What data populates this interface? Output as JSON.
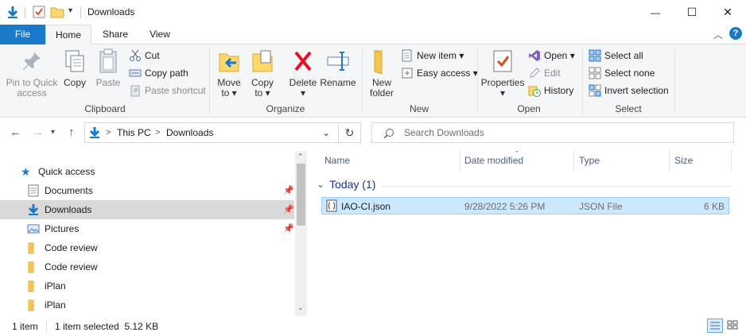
{
  "window": {
    "title": "Downloads",
    "controls": {
      "minimize": "—",
      "maximize": "☐",
      "close": "✕"
    }
  },
  "tabs": {
    "file": "File",
    "home": "Home",
    "share": "Share",
    "view": "View"
  },
  "ribbon": {
    "clipboard": {
      "label": "Clipboard",
      "pin": "Pin to Quick\naccess",
      "copy": "Copy",
      "paste": "Paste",
      "cut": "Cut",
      "copy_path": "Copy path",
      "paste_shortcut": "Paste shortcut"
    },
    "organize": {
      "label": "Organize",
      "move_to": "Move\nto ▾",
      "copy_to": "Copy\nto ▾",
      "delete": "Delete\n▾",
      "rename": "Rename"
    },
    "new": {
      "label": "New",
      "new_folder": "New\nfolder",
      "new_item": "New item ▾",
      "easy_access": "Easy access ▾"
    },
    "open": {
      "label": "Open",
      "properties": "Properties\n▾",
      "open": "Open ▾",
      "edit": "Edit",
      "history": "History"
    },
    "select": {
      "label": "Select",
      "select_all": "Select all",
      "select_none": "Select none",
      "invert": "Invert selection"
    }
  },
  "address": {
    "segments": [
      "This PC",
      "Downloads"
    ],
    "separator": ">",
    "search_placeholder": "Search Downloads"
  },
  "nav": {
    "items": [
      {
        "label": "Quick access",
        "pinned": false
      },
      {
        "label": "Documents",
        "pinned": true
      },
      {
        "label": "Downloads",
        "pinned": true
      },
      {
        "label": "Pictures",
        "pinned": true
      },
      {
        "label": "Code review",
        "pinned": false
      },
      {
        "label": "Code review",
        "pinned": false
      },
      {
        "label": "iPlan",
        "pinned": false
      },
      {
        "label": "iPlan",
        "pinned": false
      }
    ]
  },
  "files": {
    "columns": {
      "name": "Name",
      "date": "Date modified",
      "type": "Type",
      "size": "Size"
    },
    "group": "Today (1)",
    "rows": [
      {
        "name": "IAO-CI.json",
        "date": "9/28/2022 5:26 PM",
        "type": "JSON File",
        "size": "6 KB"
      }
    ]
  },
  "status": {
    "count": "1 item",
    "selected": "1 item selected  5.12 KB"
  },
  "colors": {
    "accent": "#1979ca",
    "selection": "#cce8ff",
    "folder": "#ffd86b",
    "delete_red": "#e81123",
    "help_blue": "#1979ca"
  }
}
